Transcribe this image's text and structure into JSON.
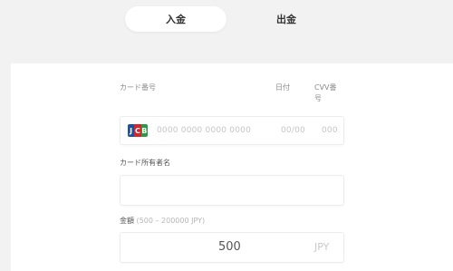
{
  "tabs": [
    {
      "label": "入金",
      "active": true
    },
    {
      "label": "出金",
      "active": false
    }
  ],
  "form": {
    "card_number_label": "カード番号",
    "date_label": "日付",
    "cvv_label_line1": "CVV番",
    "cvv_label_line2": "号",
    "card_brand": "JCB",
    "card_number_placeholder": "0000 0000 0000 0000",
    "date_placeholder": "00/00",
    "cvv_placeholder": "000",
    "holder_label": "カード所有者名",
    "holder_value": "",
    "amount_label": "金額",
    "amount_range": "(500 – 200000 JPY)",
    "amount_value": "500",
    "currency": "JPY"
  },
  "colors": {
    "background": "#f2f2f3",
    "panel": "#ffffff",
    "jcb_blue": "#1f4fa0",
    "jcb_red": "#d2262c",
    "jcb_green": "#2a9a45"
  }
}
